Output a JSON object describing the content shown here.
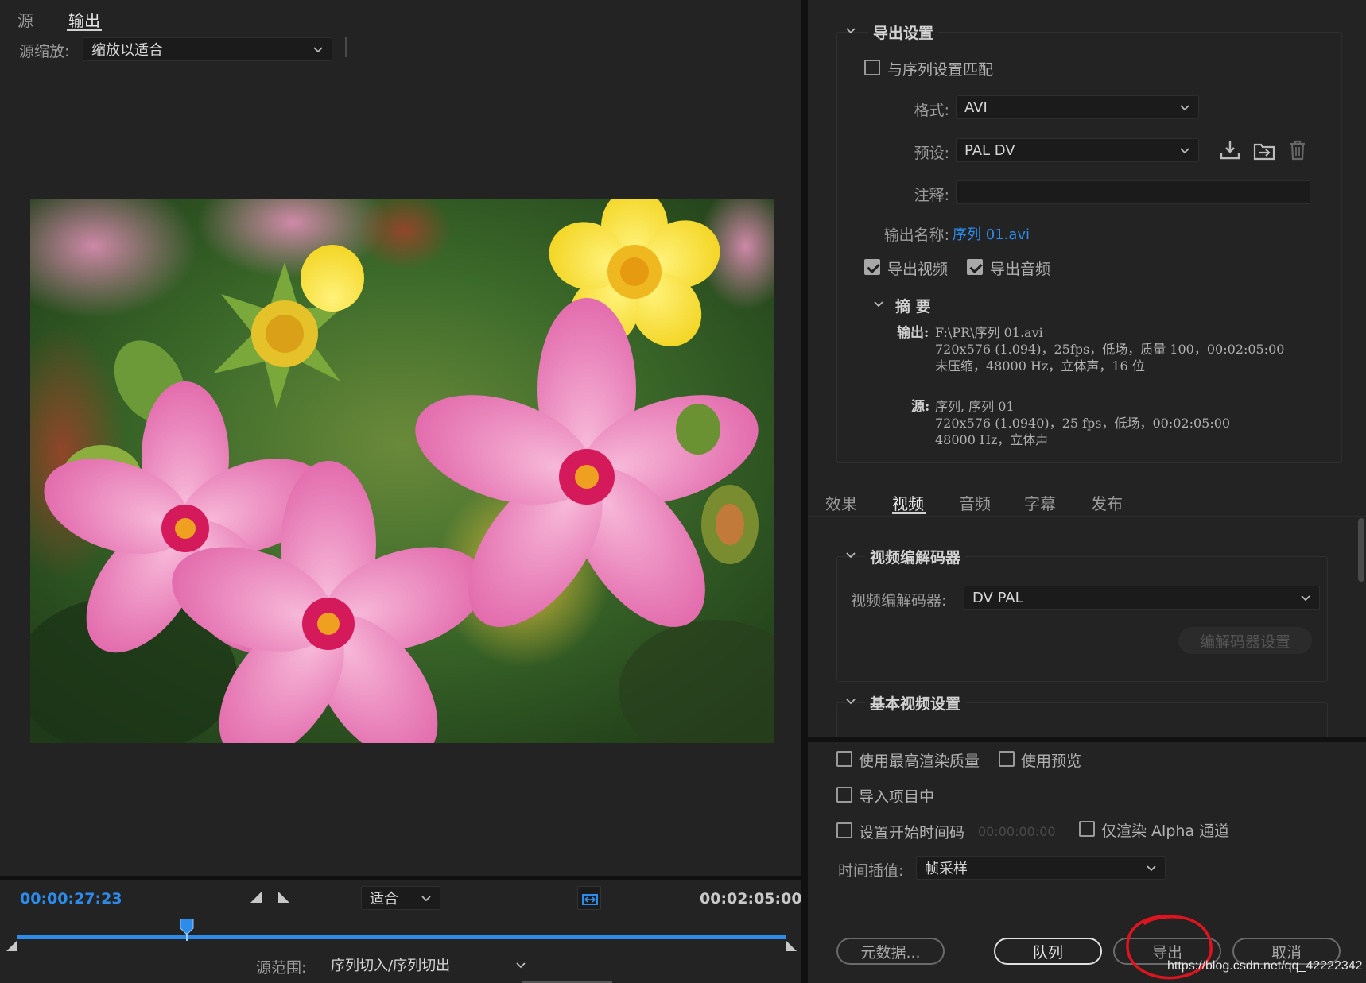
{
  "source_panel": {
    "tabs": [
      "源",
      "输出"
    ],
    "active_tab": "输出",
    "scale_label": "源缩放:",
    "scale_value": "缩放以适合"
  },
  "timeline": {
    "current_time": "00:00:27:23",
    "duration": "00:02:05:00",
    "fit_value": "适合",
    "playhead_position": 0.22,
    "source_range_label": "源范围:",
    "source_range_value": "序列切入/序列切出"
  },
  "export_settings": {
    "section_title": "导出设置",
    "match_sequence_label": "与序列设置匹配",
    "format_label": "格式:",
    "format_value": "AVI",
    "preset_label": "预设:",
    "preset_value": "PAL DV",
    "comments_label": "注释:",
    "comments_value": "",
    "output_name_label": "输出名称:",
    "output_name_value": "序列 01.avi",
    "export_video_label": "导出视频",
    "export_audio_label": "导出音频",
    "summary_title": "摘 要",
    "summary": {
      "output_key": "输出:",
      "output_lines": [
        "F:\\PR\\序列 01.avi",
        "720x576 (1.094)，25fps，低场，质量 100，00:02:05:00",
        "未压缩，48000 Hz，立体声，16 位"
      ],
      "source_key": "源:",
      "source_lines": [
        "序列, 序列 01",
        "720x576 (1.0940)，25 fps，低场，00:02:05:00",
        "48000 Hz，立体声"
      ]
    }
  },
  "settings_tabs": [
    "效果",
    "视频",
    "音频",
    "字幕",
    "发布"
  ],
  "settings_active_tab": "视频",
  "video_codec": {
    "section_title": "视频编解码器",
    "codec_label": "视频编解码器:",
    "codec_value": "DV PAL",
    "codec_settings_button": "编解码器设置"
  },
  "basic_video": {
    "section_title": "基本视频设置"
  },
  "bottom_options": {
    "max_render_quality": "使用最高渲染质量",
    "use_previews": "使用预览",
    "import_into_project": "导入项目中",
    "set_start_timecode": "设置开始时间码",
    "start_timecode_value": "00:00:00:00",
    "render_alpha_only": "仅渲染 Alpha 通道",
    "time_interpolation_label": "时间插值:",
    "time_interpolation_value": "帧采样"
  },
  "buttons": {
    "metadata": "元数据...",
    "queue": "队列",
    "export": "导出",
    "cancel": "取消"
  },
  "watermark": "https://blog.csdn.net/qq_42222342",
  "colors": {
    "accent_blue": "#2d8ceb",
    "annotation_red": "#e0141e"
  }
}
